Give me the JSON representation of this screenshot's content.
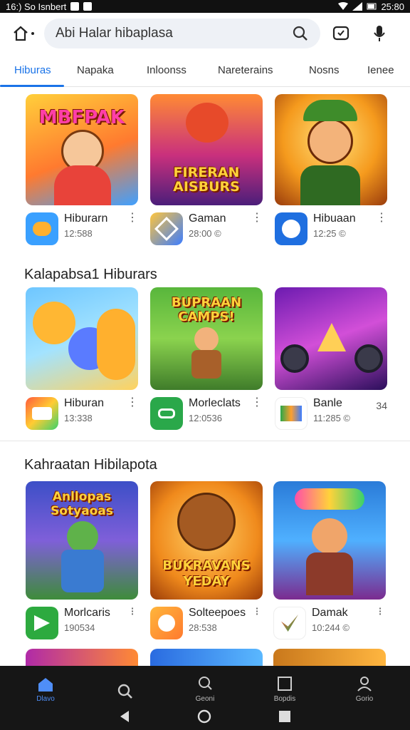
{
  "status_bar": {
    "time": "16:) So Isnbert",
    "clock": "25:80"
  },
  "search": {
    "placeholder": "Abi Halar hibaplasa"
  },
  "tabs": [
    "Hiburas",
    "Napaka",
    "Inloonss",
    "Nareterains",
    "Nosns",
    "Ienee"
  ],
  "row1": [
    {
      "thumb_title": "MBFPAK",
      "name": "Hiburarn",
      "count": "12:588",
      "icon_color": "#3aa0ff",
      "thumb_bg": "linear-gradient(160deg,#ffcf3b,#ff7a2f 55%,#3fa0ff)"
    },
    {
      "thumb_title": "FIRERAN AISBURS",
      "name": "Gaman",
      "count": "28:00 ©",
      "icon_color": "#3c7dff",
      "thumb_bg": "linear-gradient(180deg,#ff8a34,#c9307d 55%,#4b1e7a)"
    },
    {
      "thumb_title": "",
      "name": "Hibuaan",
      "count": "12:25 ©",
      "icon_color": "#1f6fe0",
      "thumb_bg": "radial-gradient(circle at 50% 40%,#ffe07a,#f59a1d 55%,#9a3c0c)"
    }
  ],
  "section1": {
    "title": "Kalapabsa1 Hiburars"
  },
  "row2": [
    {
      "thumb_title": "",
      "name": "Hiburan",
      "count": "13:338",
      "icon_color": "#ff5a3c",
      "thumb_bg": "linear-gradient(160deg,#6ec6ff,#a3e3ff 50%,#ffd25e)"
    },
    {
      "thumb_title": "BUPRAAN CAMPS!",
      "name": "Morleclats",
      "count": "12:0536",
      "icon_color": "#2aa84a",
      "thumb_bg": "linear-gradient(180deg,#58b63c,#8bd34e 50%,#3f7c2a)"
    },
    {
      "thumb_title": "",
      "name": "Banle",
      "count": "11:285 ©",
      "icon_color": "#ffffff",
      "thumb_bg": "linear-gradient(160deg,#6c1bb0,#d24fd8 50%,#2b0f5b)",
      "extra": "34"
    }
  ],
  "section2": {
    "title": "Kahraatan Hibilapota"
  },
  "row3": [
    {
      "thumb_title": "Anllopas Sotyaoas",
      "name": "Morlcaris",
      "count": "190534",
      "icon_color": "#2daa3f",
      "thumb_bg": "linear-gradient(180deg,#3c4fc7,#7f5fd9 50%,#3e8c3a)"
    },
    {
      "thumb_title": "BUKRAVANS YEDAY",
      "name": "Solteepoes",
      "count": "28:538",
      "icon_color": "#ff9f2d",
      "thumb_bg": "radial-gradient(circle at 50% 45%,#ffd066,#f08a1c 60%,#9c3c08)"
    },
    {
      "thumb_title": "",
      "name": "Damak",
      "count": "10:244 ©",
      "icon_color": "#ffffff",
      "thumb_bg": "linear-gradient(180deg,#2a7bd8,#4fb0ff 50%,#7b2b8f)"
    }
  ],
  "bottom_nav": [
    {
      "label": "Dlavo",
      "icon": "home-icon"
    },
    {
      "label": "",
      "icon": "search-icon"
    },
    {
      "label": "Geoni",
      "icon": "search-icon"
    },
    {
      "label": "Bopdis",
      "icon": "square-icon"
    },
    {
      "label": "Gorio",
      "icon": "person-icon"
    }
  ]
}
